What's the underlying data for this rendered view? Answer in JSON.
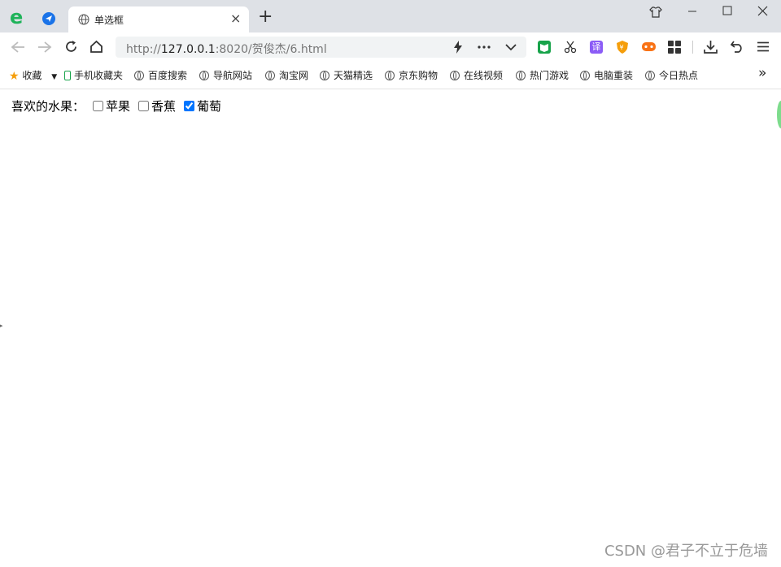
{
  "window": {
    "tab_title": "单选框",
    "new_tab": "+",
    "close_tab": "×",
    "url_protocol": "http://",
    "url_host": "127.0.0.1",
    "url_rest": ":8020/贺俊杰/6.html",
    "translate_label": "译"
  },
  "bookmarks": [
    {
      "label": "收藏",
      "icon": "star-icon"
    },
    {
      "label": "手机收藏夹",
      "icon": "phone-icon"
    },
    {
      "label": "百度搜索",
      "icon": "globe-icon"
    },
    {
      "label": "导航网站",
      "icon": "globe-icon"
    },
    {
      "label": "淘宝网",
      "icon": "globe-icon"
    },
    {
      "label": "天猫精选",
      "icon": "globe-icon"
    },
    {
      "label": "京东购物",
      "icon": "globe-icon"
    },
    {
      "label": "在线视频",
      "icon": "globe-icon"
    },
    {
      "label": "热门游戏",
      "icon": "globe-icon"
    },
    {
      "label": "电脑重装",
      "icon": "globe-icon"
    },
    {
      "label": "今日热点",
      "icon": "globe-icon"
    }
  ],
  "bookmarks_more": "»",
  "form": {
    "label": "喜欢的水果：",
    "options": [
      {
        "label": "苹果",
        "checked": false
      },
      {
        "label": "香蕉",
        "checked": false
      },
      {
        "label": "葡萄",
        "checked": true
      }
    ]
  },
  "watermark": "CSDN @君子不立于危墙",
  "colors": {
    "accent": "#1a73e8",
    "tabbar": "#dee1e6",
    "urlbar": "#f1f3f4"
  }
}
